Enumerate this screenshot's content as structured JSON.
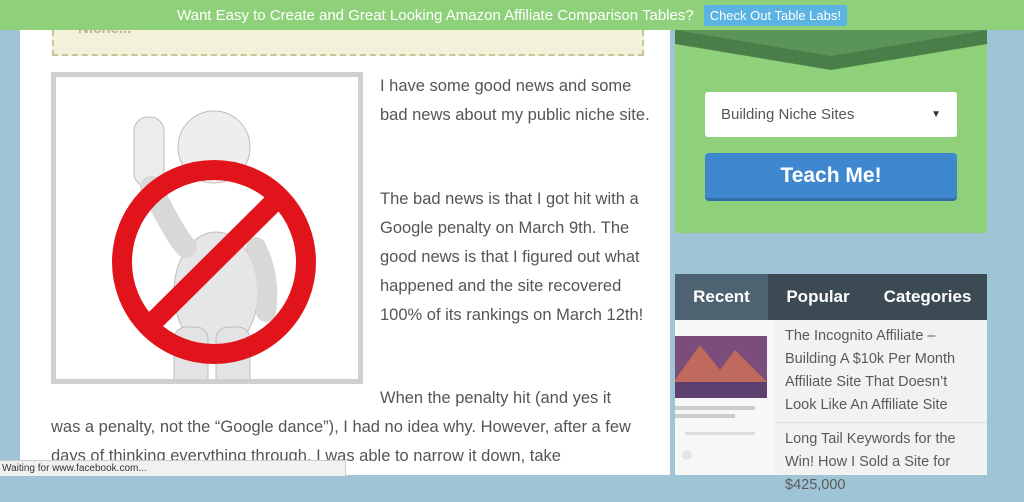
{
  "banner": {
    "text": "Want Easy to Create and Great Looking Amazon Affiliate Comparison Tables?",
    "cta": "Check Out Table Labs!"
  },
  "article": {
    "callout_fragment": "Niche...",
    "image_icon": "no-entry-figure-icon",
    "paragraphs": [
      "I have some good news and some bad news about my public niche site.",
      "The bad news is that I got hit with a Google penalty on March 9th. The good news is that I figured out what happened and the site recovered 100% of its rankings on March 12th!",
      "When the penalty hit (and yes it",
      "was a penalty, not the “Google dance”), I had no idea why.  However, after a few days of thinking everything through, I was able to narrow it down, take"
    ]
  },
  "sidebar": {
    "select_value": "Building Niche Sites",
    "teach_button": "Teach Me!",
    "accent": "#8fd17a",
    "button_color": "#3f88cf"
  },
  "tabs": [
    "Recent",
    "Popular",
    "Categories"
  ],
  "recent_posts": [
    "The Incognito Affiliate – Building A $10k Per Month Affiliate Site That Doesn’t Look Like An Affiliate Site",
    "Long Tail Keywords for the Win! How I Sold a Site for $425,000"
  ],
  "status_bar": "Waiting for www.facebook.com..."
}
